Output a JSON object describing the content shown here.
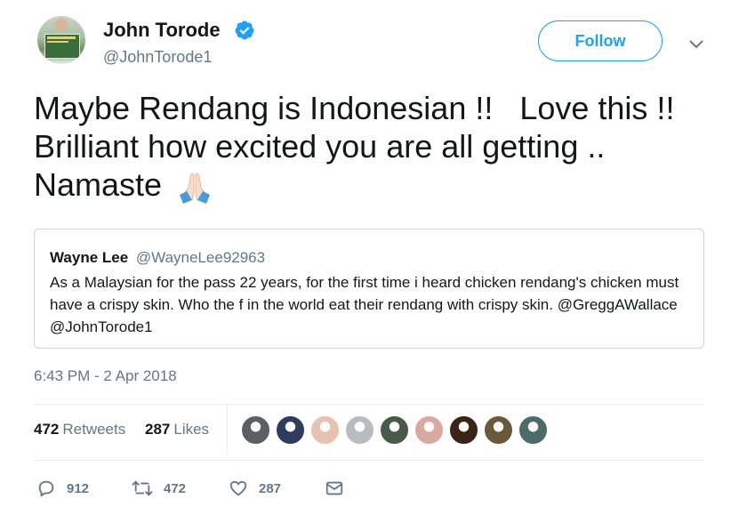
{
  "author": {
    "name": "John Torode",
    "handle": "@JohnTorode1",
    "verified": true
  },
  "follow_button": {
    "label": "Follow"
  },
  "tweet": {
    "line1": "Maybe Rendang is Indonesian !!   Love this !!",
    "line2": "Brilliant how excited you are all getting ..",
    "line3": "Namaste",
    "emoji": "folded-hands-emoji",
    "timestamp": "6:43 PM - 2 Apr 2018"
  },
  "quoted_tweet": {
    "name": "Wayne Lee",
    "handle": "@WayneLee92963",
    "text": "As a Malaysian for the pass 22 years, for the first time i heard chicken rendang's chicken must have a crispy skin. Who the f in the world eat their rendang with crispy skin. @GreggAWallace @JohnTorode1"
  },
  "stats": {
    "retweets_count": "472",
    "retweets_label": "Retweets",
    "likes_count": "287",
    "likes_label": "Likes"
  },
  "liker_avatars": [
    "#5a5f66",
    "#2e3c5e",
    "#e6c2b0",
    "#b8bcc0",
    "#4a5a48",
    "#d9a8a0",
    "#3a2418",
    "#6b5a3a",
    "#4c6b6a"
  ],
  "actions": {
    "replies": "912",
    "retweets": "472",
    "likes": "287"
  },
  "colors": {
    "accent": "#1da1f2",
    "secondary_text": "#657786",
    "border": "#ccd6dd"
  }
}
